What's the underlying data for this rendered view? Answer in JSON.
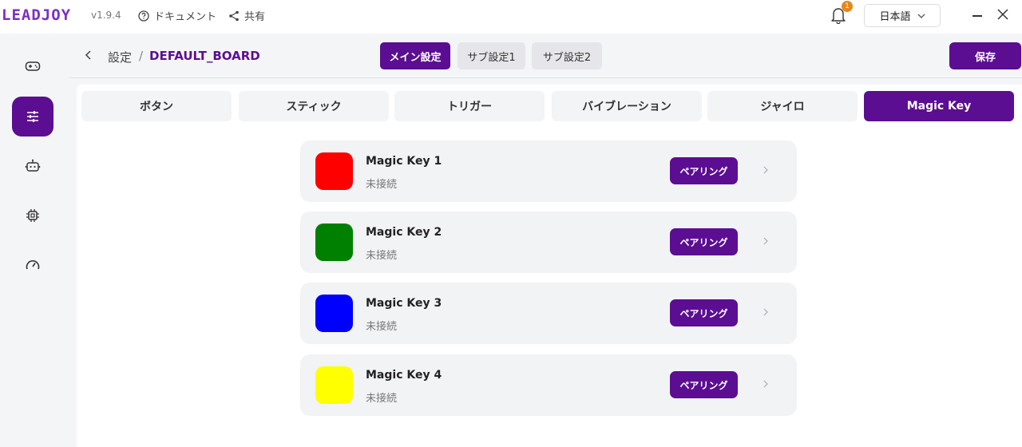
{
  "app": {
    "logo": "LEADJOY",
    "version": "v1.9.4",
    "doc_label": "ドキュメント",
    "share_label": "共有",
    "notification_count": "1",
    "language": "日本語"
  },
  "sidebar": {
    "items": [
      {
        "icon": "gamepad-icon",
        "active": false
      },
      {
        "icon": "sliders-icon",
        "active": true
      },
      {
        "icon": "robot-icon",
        "active": false
      },
      {
        "icon": "chip-icon",
        "active": false
      },
      {
        "icon": "gauge-icon",
        "active": false
      }
    ]
  },
  "header": {
    "breadcrumb_root": "設定",
    "breadcrumb_sep": "/",
    "breadcrumb_current": "DEFAULT_BOARD",
    "config_tabs": [
      {
        "label": "メイン設定",
        "active": true
      },
      {
        "label": "サブ設定1",
        "active": false
      },
      {
        "label": "サブ設定2",
        "active": false
      }
    ],
    "save_label": "保存"
  },
  "tabs": [
    {
      "label": "ボタン",
      "active": false
    },
    {
      "label": "スティック",
      "active": false
    },
    {
      "label": "トリガー",
      "active": false
    },
    {
      "label": "バイブレーション",
      "active": false
    },
    {
      "label": "ジャイロ",
      "active": false
    },
    {
      "label": "Magic Key",
      "active": true
    }
  ],
  "magic_keys": [
    {
      "name": "Magic Key 1",
      "status": "未接続",
      "color": "#ff0000",
      "button": "ペアリング"
    },
    {
      "name": "Magic Key 2",
      "status": "未接続",
      "color": "#008000",
      "button": "ペアリング"
    },
    {
      "name": "Magic Key 3",
      "status": "未接続",
      "color": "#0000ff",
      "button": "ペアリング"
    },
    {
      "name": "Magic Key 4",
      "status": "未接続",
      "color": "#ffff00",
      "button": "ペアリング"
    }
  ],
  "colors": {
    "accent": "#5b0e91",
    "logo": "#7b2fc9",
    "badge": "#e8871a"
  }
}
